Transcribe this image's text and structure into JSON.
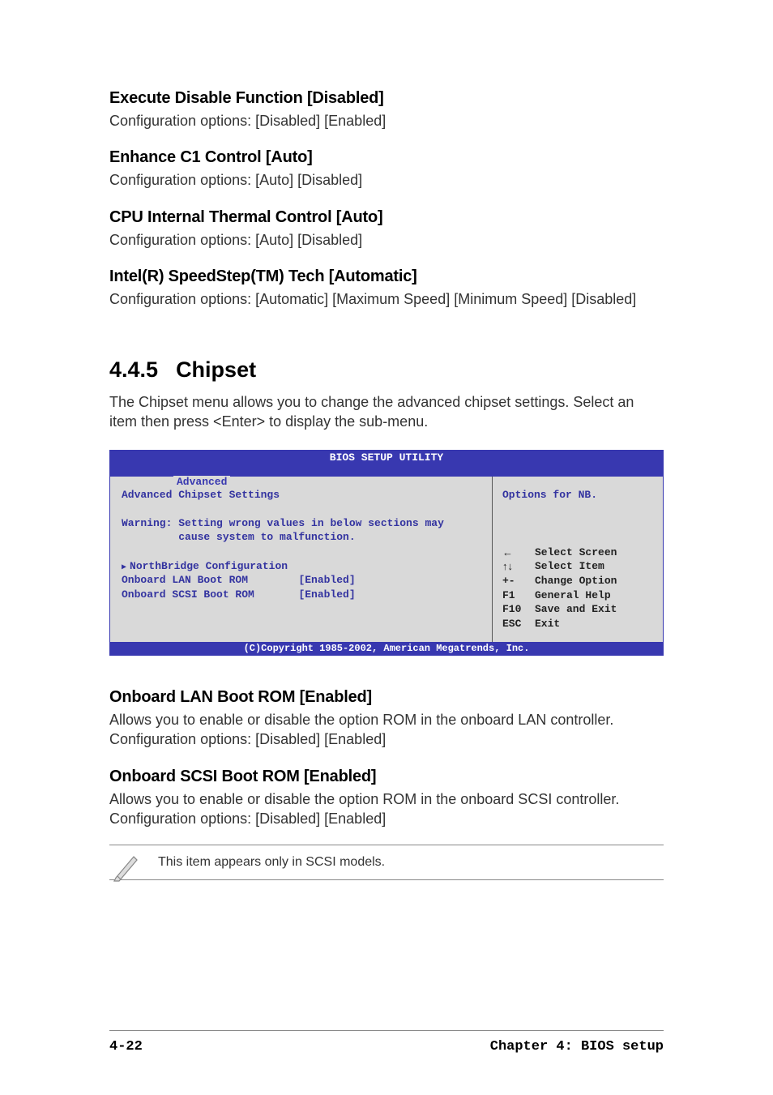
{
  "sections": {
    "s1": {
      "heading": "Execute Disable Function [Disabled]",
      "text": "Configuration options: [Disabled] [Enabled]"
    },
    "s2": {
      "heading": "Enhance C1 Control [Auto]",
      "text": "Configuration options: [Auto] [Disabled]"
    },
    "s3": {
      "heading": "CPU Internal Thermal Control [Auto]",
      "text": "Configuration options: [Auto] [Disabled]"
    },
    "s4": {
      "heading": "Intel(R) SpeedStep(TM) Tech [Automatic]",
      "text": "Configuration options: [Automatic] [Maximum Speed] [Minimum Speed] [Disabled]"
    }
  },
  "chapter": {
    "num": "4.4.5",
    "title": "Chipset",
    "intro": "The Chipset menu allows you to change the advanced chipset settings. Select an item then press <Enter> to display the sub-menu."
  },
  "bios": {
    "title": "BIOS SETUP UTILITY",
    "tab": "Advanced",
    "main_heading": "Advanced Chipset Settings",
    "warning_l1": "Warning: Setting wrong values in below sections may",
    "warning_l2": "         cause system to malfunction.",
    "item1": "NorthBridge Configuration",
    "item2_label": "Onboard LAN Boot ROM",
    "item2_value": "[Enabled]",
    "item3_label": "Onboard SCSI Boot ROM",
    "item3_value": "[Enabled]",
    "side_heading": "Options for NB.",
    "nav": {
      "r1k": "←",
      "r1v": "Select Screen",
      "r2k": "↑↓",
      "r2v": "Select Item",
      "r3k": "+-",
      "r3v": "Change Option",
      "r4k": "F1",
      "r4v": "General Help",
      "r5k": "F10",
      "r5v": "Save and Exit",
      "r6k": "ESC",
      "r6v": "Exit"
    },
    "footer": "(C)Copyright 1985-2002, American Megatrends, Inc."
  },
  "post": {
    "s5": {
      "heading": "Onboard LAN Boot ROM [Enabled]",
      "text": "Allows you to enable or disable the option ROM in the onboard LAN controller. Configuration options: [Disabled] [Enabled]"
    },
    "s6": {
      "heading": "Onboard SCSI Boot ROM [Enabled]",
      "text": "Allows you to enable or disable the option ROM in the onboard SCSI controller. Configuration options: [Disabled] [Enabled]"
    }
  },
  "note": "This item appears only in SCSI models.",
  "footer": {
    "left": "4-22",
    "right": "Chapter 4: BIOS setup"
  }
}
